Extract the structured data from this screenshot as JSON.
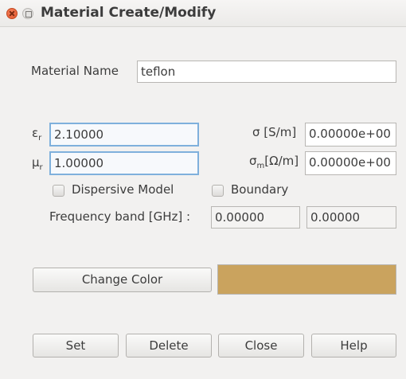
{
  "window": {
    "title": "Material Create/Modify"
  },
  "material": {
    "name_label": "Material Name",
    "name_value": "teflon"
  },
  "params": {
    "eps_symbol": "ε",
    "eps_sub": "r",
    "eps_value": "2.10000",
    "mu_symbol": "μ",
    "mu_sub": "r",
    "mu_value": "1.00000",
    "sigma_label": "σ [S/m]",
    "sigma_value": "0.00000e+00",
    "sigma_m_symbol": "σ",
    "sigma_m_sub": "m",
    "sigma_m_unit": "[Ω/m]",
    "sigma_m_value": "0.00000e+00"
  },
  "options": {
    "dispersive_label": "Dispersive Model",
    "boundary_label": "Boundary",
    "freq_label": "Frequency band [GHz] :",
    "freq_low": "0.00000",
    "freq_high": "0.00000"
  },
  "color": {
    "change_label": "Change Color",
    "swatch": "#caa35e"
  },
  "actions": {
    "set_label": "Set",
    "delete_label": "Delete",
    "close_label": "Close",
    "help_label": "Help"
  }
}
